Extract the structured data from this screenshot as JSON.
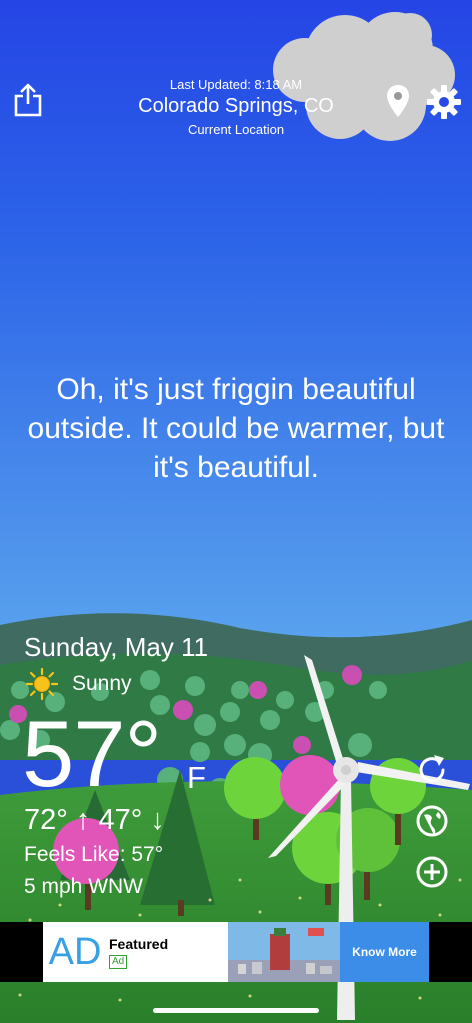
{
  "header": {
    "last_updated": "Last Updated: 8:18 AM",
    "city": "Colorado Springs, CO",
    "location_label": "Current Location"
  },
  "message": "Oh, it's just friggin beautiful outside. It could be warmer, but it's beautiful.",
  "weather": {
    "date": "Sunday, May 11",
    "condition": "Sunny",
    "condition_icon": "sun-icon",
    "temperature": "57°",
    "unit": "F",
    "high_low": "72° ↑ 47° ↓",
    "feels_like": "Feels Like: 57°",
    "wind": "5 mph WNW"
  },
  "actions": {
    "share_icon": "share-icon",
    "location_icon": "map-pin-icon",
    "settings_icon": "gear-icon",
    "refresh_icon": "refresh-icon",
    "globe_icon": "globe-icon",
    "add_icon": "plus-circle-icon"
  },
  "ad": {
    "logo": "AD",
    "title": "Featured",
    "badge": "Ad",
    "cta": "Know More"
  },
  "colors": {
    "sky_top": "#2747e6",
    "sky_bottom": "#5aa2ee",
    "hill_dark": "#3d6a5a",
    "grass": "#2c8a2c",
    "ad_cta": "#3b8de8"
  }
}
